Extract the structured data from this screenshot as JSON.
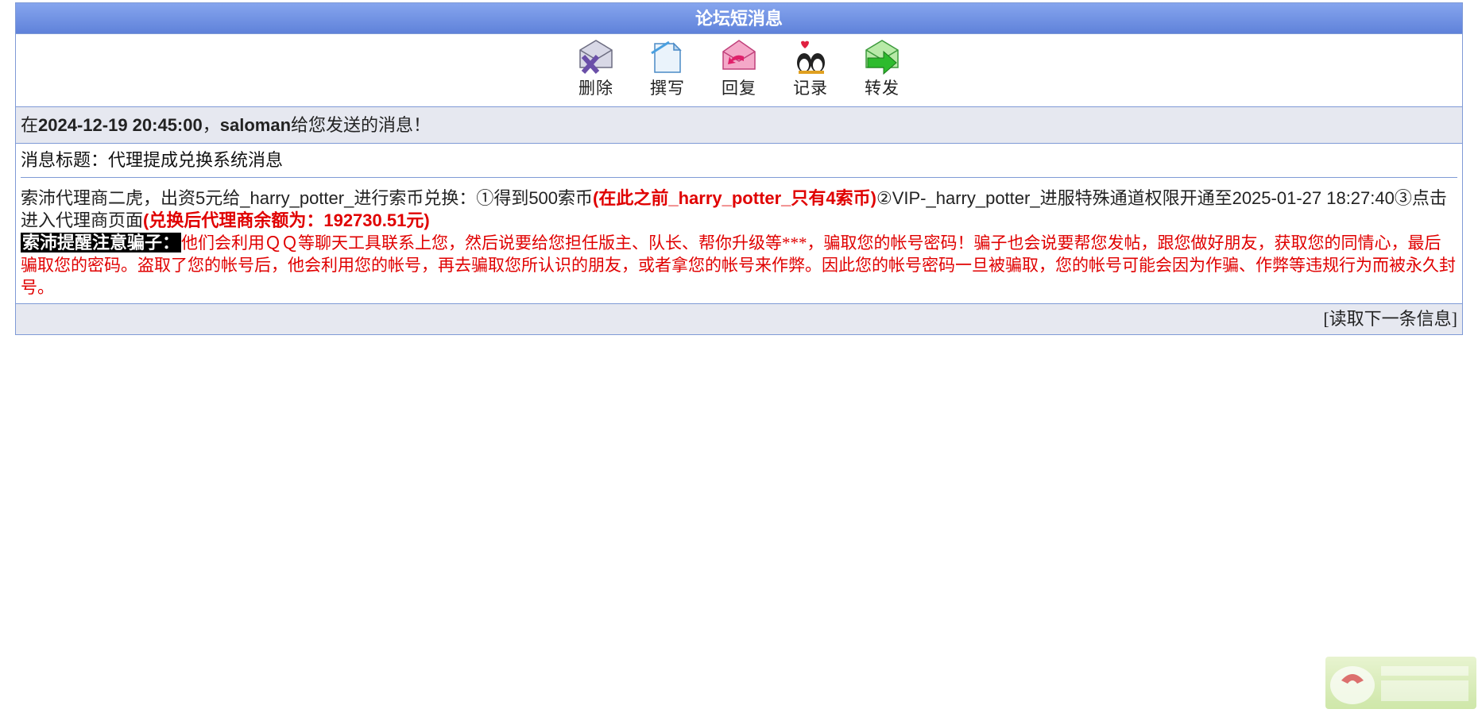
{
  "header": {
    "title": "论坛短消息"
  },
  "toolbar": {
    "items": [
      {
        "label": "删除",
        "icon": "delete-icon"
      },
      {
        "label": "撰写",
        "icon": "compose-icon"
      },
      {
        "label": "回复",
        "icon": "reply-icon"
      },
      {
        "label": "记录",
        "icon": "records-icon"
      },
      {
        "label": "转发",
        "icon": "forward-icon"
      }
    ]
  },
  "message_info": {
    "prefix": "在",
    "datetime": "2024-12-19 20:45:00",
    "sep": "，",
    "sender": "saloman",
    "suffix": "给您发送的消息！"
  },
  "subject": {
    "text": "消息标题：代理提成兑换系统消息"
  },
  "body": {
    "part1": "索沛代理商二虎，出资5元给_harry_potter_进行索币兑换：①得到500索币",
    "part2": "(在此之前_harry_potter_只有4索币)",
    "part3": "②VIP-_harry_potter_进服特殊通道权限开通至2025-01-27 18:27:40③点击进入代理商页面",
    "part4": "(兑换后代理商余额为：192730.51元)",
    "warning_label": "索沛提醒注意骗子：",
    "warning_text": "他们会利用ＱＱ等聊天工具联系上您，然后说要给您担任版主、队长、帮你升级等***，骗取您的帐号密码！骗子也会说要帮您发帖，跟您做好朋友，获取您的同情心，最后骗取您的密码。盗取了您的帐号后，他会利用您的帐号，再去骗取您所认识的朋友，或者拿您的帐号来作弊。因此您的帐号密码一旦被骗取，您的帐号可能会因为作骗、作弊等违规行为而被永久封号。"
  },
  "footer": {
    "open": "[",
    "next_link": "读取下一条信息",
    "close": "]"
  },
  "colors": {
    "header_blue": "#6f90e2",
    "alert_red": "#e00000",
    "info_bg": "#e6e8f0"
  }
}
